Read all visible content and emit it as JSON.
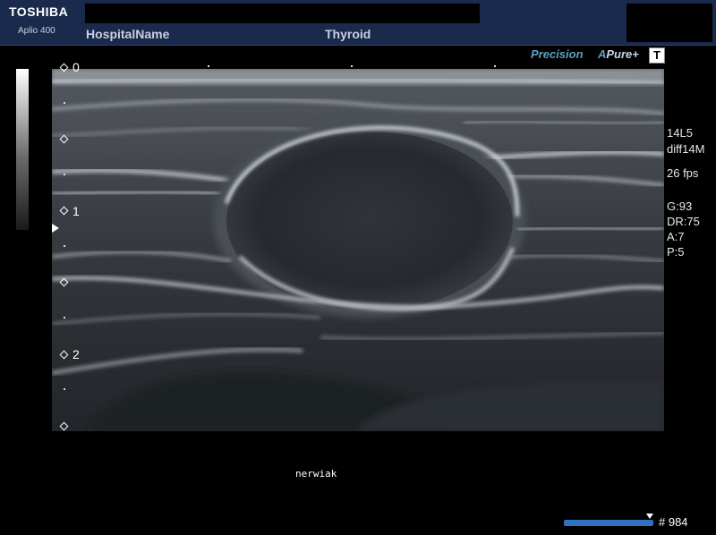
{
  "header": {
    "brand": "TOSHIBA",
    "model": "Aplio 400",
    "hospital": "HospitalName",
    "exam": "Thyroid"
  },
  "overlay": {
    "precision": "Precision",
    "apure_a": "A",
    "apure_rest": "Pure+",
    "t_label": "T"
  },
  "depth_scale": {
    "labels": [
      "0",
      "1",
      "2"
    ]
  },
  "params": {
    "probe": "14L5",
    "mode": "diff14M",
    "fps": "26 fps",
    "gain": "G:93",
    "dynamic_range": "DR:75",
    "a": "A:7",
    "p": "P:5"
  },
  "annotation": "nerwiak",
  "cine": {
    "frame": "# 984"
  },
  "colors": {
    "header_bg": "#1a2a4c",
    "accent": "#5aa0c0",
    "cine_bar": "#2f72c4"
  },
  "icons": [
    "focus-marker-icon",
    "cine-marker-icon"
  ]
}
